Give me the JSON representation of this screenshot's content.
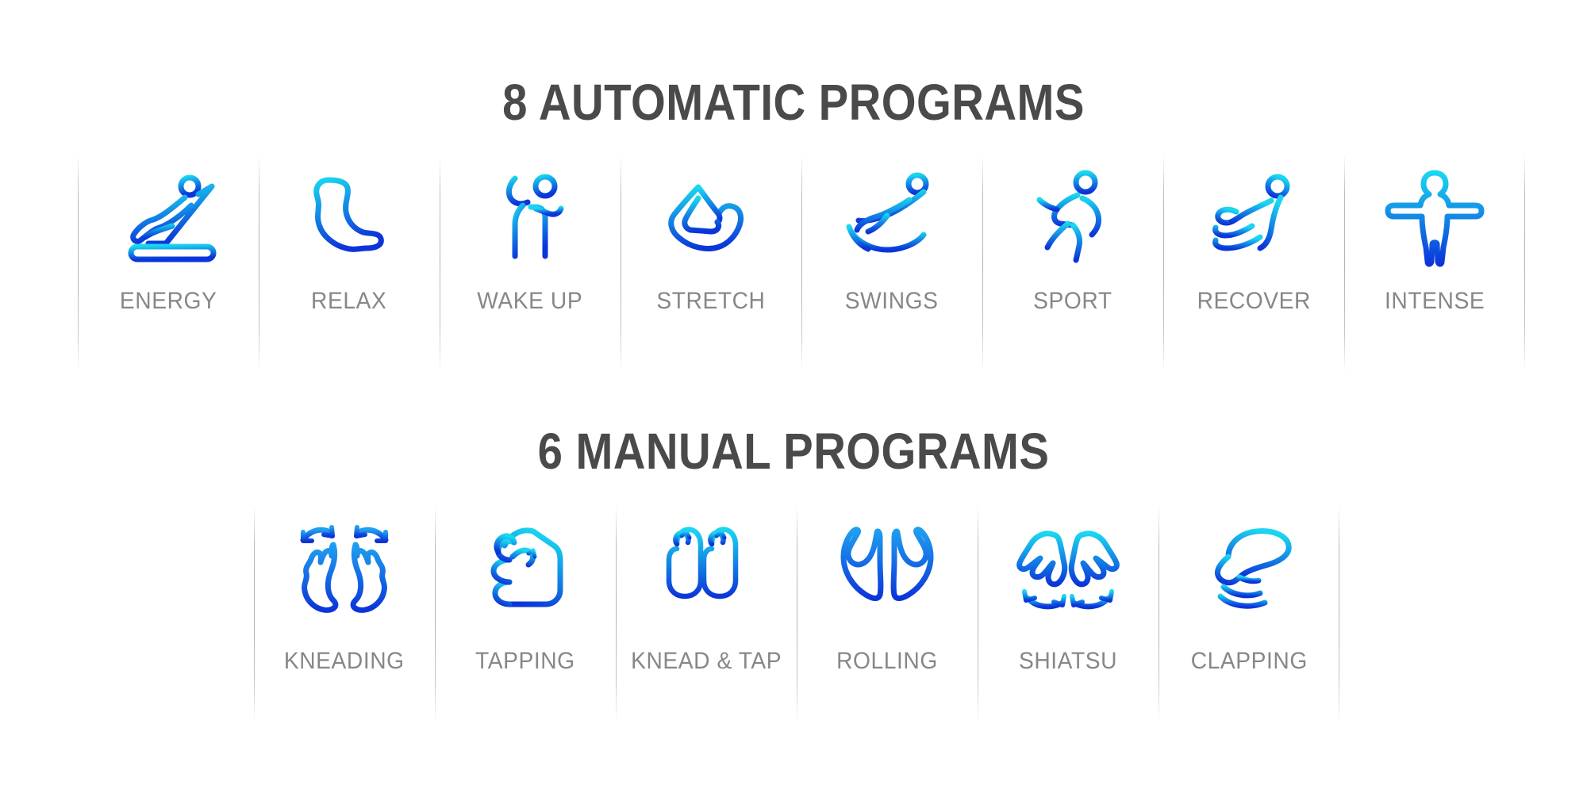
{
  "background_color": "#ffffff",
  "theme": {
    "heading_color": "#4a4a4a",
    "label_color": "#878787",
    "divider_color": "#b4b4b4",
    "gradient_start": "#1ad6f0",
    "gradient_end": "#0b35d9"
  },
  "sections": [
    {
      "id": "automatic",
      "title": "8 AUTOMATIC PROGRAMS",
      "count": 8,
      "items": [
        {
          "label": "ENERGY",
          "icon": "reclining-chair-icon"
        },
        {
          "label": "RELAX",
          "icon": "relaxed-body-icon"
        },
        {
          "label": "WAKE UP",
          "icon": "person-stretching-arm-icon"
        },
        {
          "label": "STRETCH",
          "icon": "stretch-shape-icon"
        },
        {
          "label": "SWINGS",
          "icon": "rocking-person-icon"
        },
        {
          "label": "SPORT",
          "icon": "running-person-icon"
        },
        {
          "label": "RECOVER",
          "icon": "seated-recovery-icon"
        },
        {
          "label": "INTENSE",
          "icon": "arms-outstretched-person-icon"
        }
      ]
    },
    {
      "id": "manual",
      "title": "6 MANUAL PROGRAMS",
      "count": 6,
      "items": [
        {
          "label": "KNEADING",
          "icon": "two-hands-rotating-icon"
        },
        {
          "label": "TAPPING",
          "icon": "fist-icon"
        },
        {
          "label": "KNEAD & TAP",
          "icon": "two-fists-up-icon"
        },
        {
          "label": "ROLLING",
          "icon": "two-hands-rolling-icon"
        },
        {
          "label": "SHIATSU",
          "icon": "two-pointing-hands-icon"
        },
        {
          "label": "CLAPPING",
          "icon": "open-palm-waves-icon"
        }
      ]
    }
  ]
}
